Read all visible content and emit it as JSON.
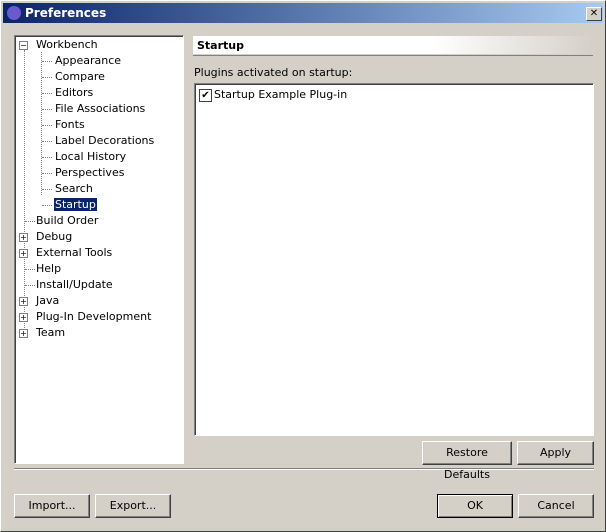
{
  "window": {
    "title": "Preferences",
    "close_label": "✕"
  },
  "tree": {
    "items": [
      {
        "label": "Workbench",
        "expander": "−"
      },
      {
        "label": "Appearance"
      },
      {
        "label": "Compare"
      },
      {
        "label": "Editors"
      },
      {
        "label": "File Associations"
      },
      {
        "label": "Fonts"
      },
      {
        "label": "Label Decorations"
      },
      {
        "label": "Local History"
      },
      {
        "label": "Perspectives"
      },
      {
        "label": "Search"
      },
      {
        "label": "Startup",
        "selected": true
      },
      {
        "label": "Build Order"
      },
      {
        "label": "Debug",
        "expander": "+"
      },
      {
        "label": "External Tools",
        "expander": "+"
      },
      {
        "label": "Help"
      },
      {
        "label": "Install/Update"
      },
      {
        "label": "Java",
        "expander": "+"
      },
      {
        "label": "Plug-In Development",
        "expander": "+"
      },
      {
        "label": "Team",
        "expander": "+"
      }
    ]
  },
  "panel": {
    "title": "Startup",
    "plugins_label": "Plugins activated on startup:",
    "plugins": [
      {
        "label": "Startup Example Plug-in",
        "checked": true
      }
    ],
    "check_mark": "✔"
  },
  "buttons": {
    "restore_defaults": "Restore Defaults",
    "apply": "Apply",
    "import": "Import...",
    "export": "Export...",
    "ok": "OK",
    "cancel": "Cancel"
  }
}
